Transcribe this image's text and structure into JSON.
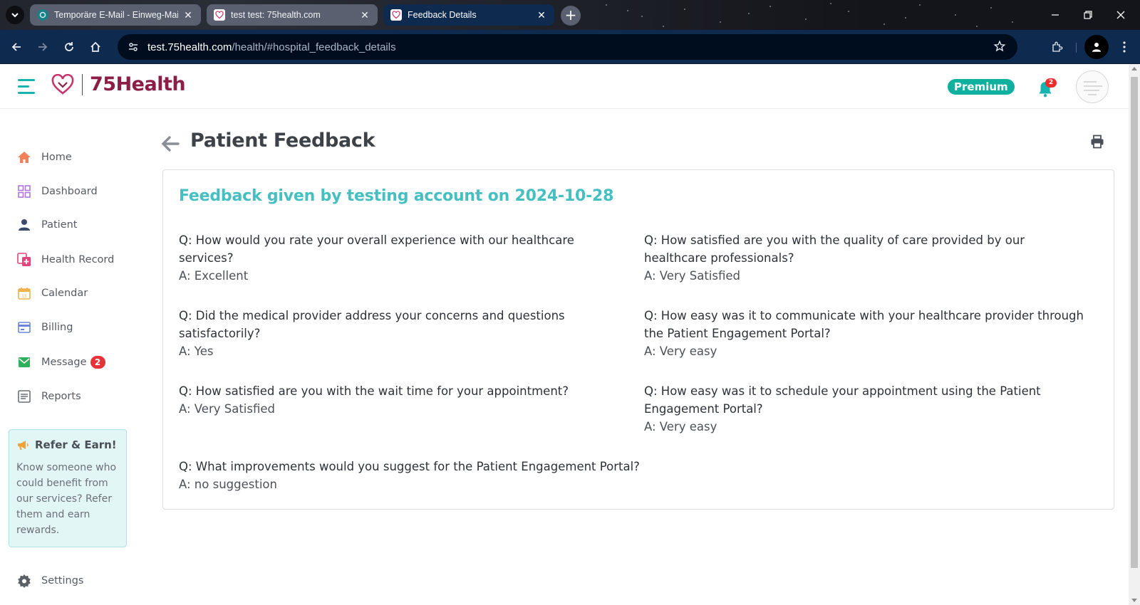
{
  "browser": {
    "tabs": [
      {
        "title": "Temporäre E-Mail - Einweg-Mail",
        "active": false,
        "favicon": "tempmail-icon"
      },
      {
        "title": "test test: 75health.com",
        "active": false,
        "favicon": "heart-logo-icon"
      },
      {
        "title": "Feedback Details",
        "active": true,
        "favicon": "heart-logo-icon"
      }
    ],
    "url_host": "test.75health.com",
    "url_path": "/health/#hospital_feedback_details"
  },
  "header": {
    "brand": "75Health",
    "premium_label": "Premium",
    "notification_count": "2"
  },
  "sidebar": {
    "items": [
      {
        "label": "Home",
        "icon": "home-icon",
        "color": "#f2815a"
      },
      {
        "label": "Dashboard",
        "icon": "dashboard-icon",
        "color": "#b074e0"
      },
      {
        "label": "Patient",
        "icon": "patient-icon",
        "color": "#3b4a6b"
      },
      {
        "label": "Health Record",
        "icon": "health-record-icon",
        "color": "#e0457b"
      },
      {
        "label": "Calendar",
        "icon": "calendar-icon",
        "color": "#f0b24a"
      },
      {
        "label": "Billing",
        "icon": "billing-icon",
        "color": "#6a86d8"
      },
      {
        "label": "Message",
        "icon": "message-icon",
        "color": "#2fae5b"
      },
      {
        "label": "Reports",
        "icon": "reports-icon",
        "color": "#6b6f76"
      }
    ],
    "message_badge": "2",
    "refer": {
      "title": "Refer & Earn!",
      "text": "Know someone who could benefit from our services? Refer them and earn rewards."
    },
    "settings_label": "Settings"
  },
  "main": {
    "page_title": "Patient Feedback",
    "card_heading": "Feedback given by testing account on 2024-10-28",
    "qa": [
      {
        "q": "Q: How would you rate your overall experience with our healthcare services?",
        "a": "A: Excellent"
      },
      {
        "q": "Q: How satisfied are you with the quality of care provided by our healthcare professionals?",
        "a": "A: Very Satisfied"
      },
      {
        "q": "Q: Did the medical provider address your concerns and questions satisfactorily?",
        "a": "A: Yes"
      },
      {
        "q": "Q: How easy was it to communicate with your healthcare provider through the Patient Engagement Portal?",
        "a": "A: Very easy"
      },
      {
        "q": "Q: How satisfied are you with the wait time for your appointment?",
        "a": "A: Very Satisfied"
      },
      {
        "q": "Q: How easy was it to schedule your appointment using the Patient Engagement Portal?",
        "a": "A: Very easy"
      },
      {
        "q": "Q: What improvements would you suggest for the Patient Engagement Portal?",
        "a": "A: no suggestion"
      }
    ]
  },
  "colors": {
    "brand_teal": "#17b3b0",
    "brand_maroon": "#8a1e46",
    "heading_teal": "#45bfbf",
    "premium_green": "#0fb09e",
    "badge_red": "#e8323a"
  }
}
